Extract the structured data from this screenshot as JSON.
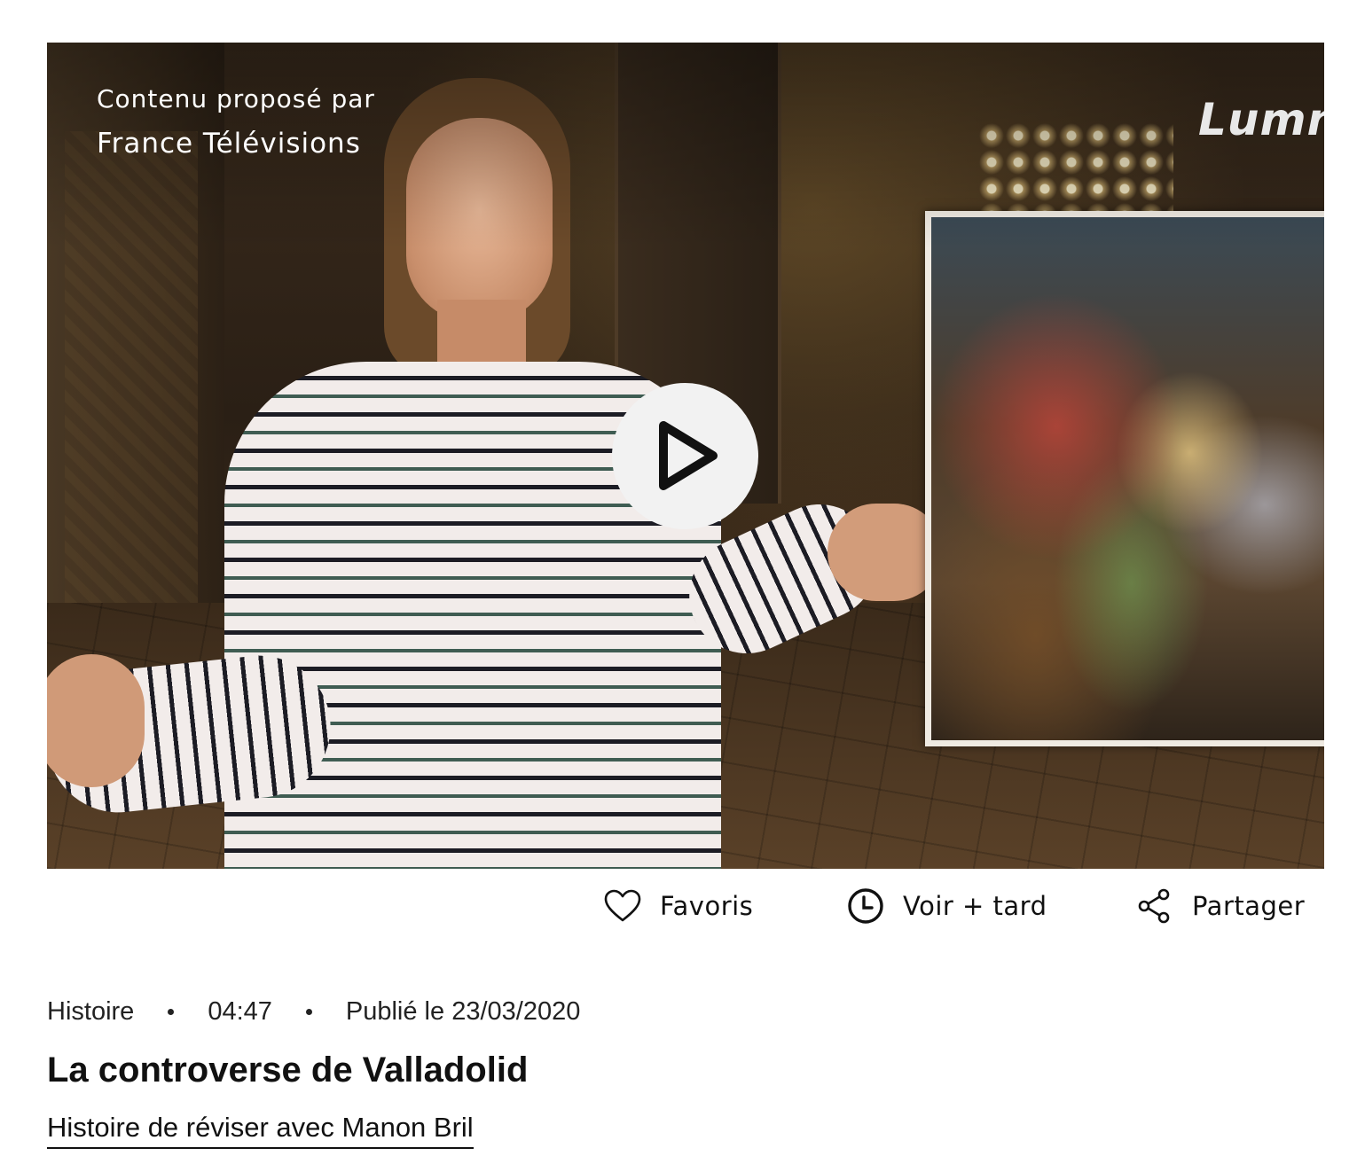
{
  "player": {
    "provider_line1": "Contenu proposé par",
    "provider_line2": "France Télévisions",
    "channel_logo_text": "Lumn",
    "play_icon": "play-icon"
  },
  "actions": {
    "favorites": {
      "label": "Favoris",
      "icon": "heart-icon"
    },
    "watch_later": {
      "label": "Voir + tard",
      "icon": "clock-icon"
    },
    "share": {
      "label": "Partager",
      "icon": "share-icon"
    }
  },
  "meta": {
    "subject": "Histoire",
    "duration": "04:47",
    "published": "Publié le 23/03/2020"
  },
  "video": {
    "title": "La controverse de Valladolid",
    "series_link": "Histoire de réviser avec Manon Bril"
  },
  "colors": {
    "text": "#111111",
    "play_button_bg": "#f2f2f2",
    "overlay_text": "#ffffff"
  }
}
